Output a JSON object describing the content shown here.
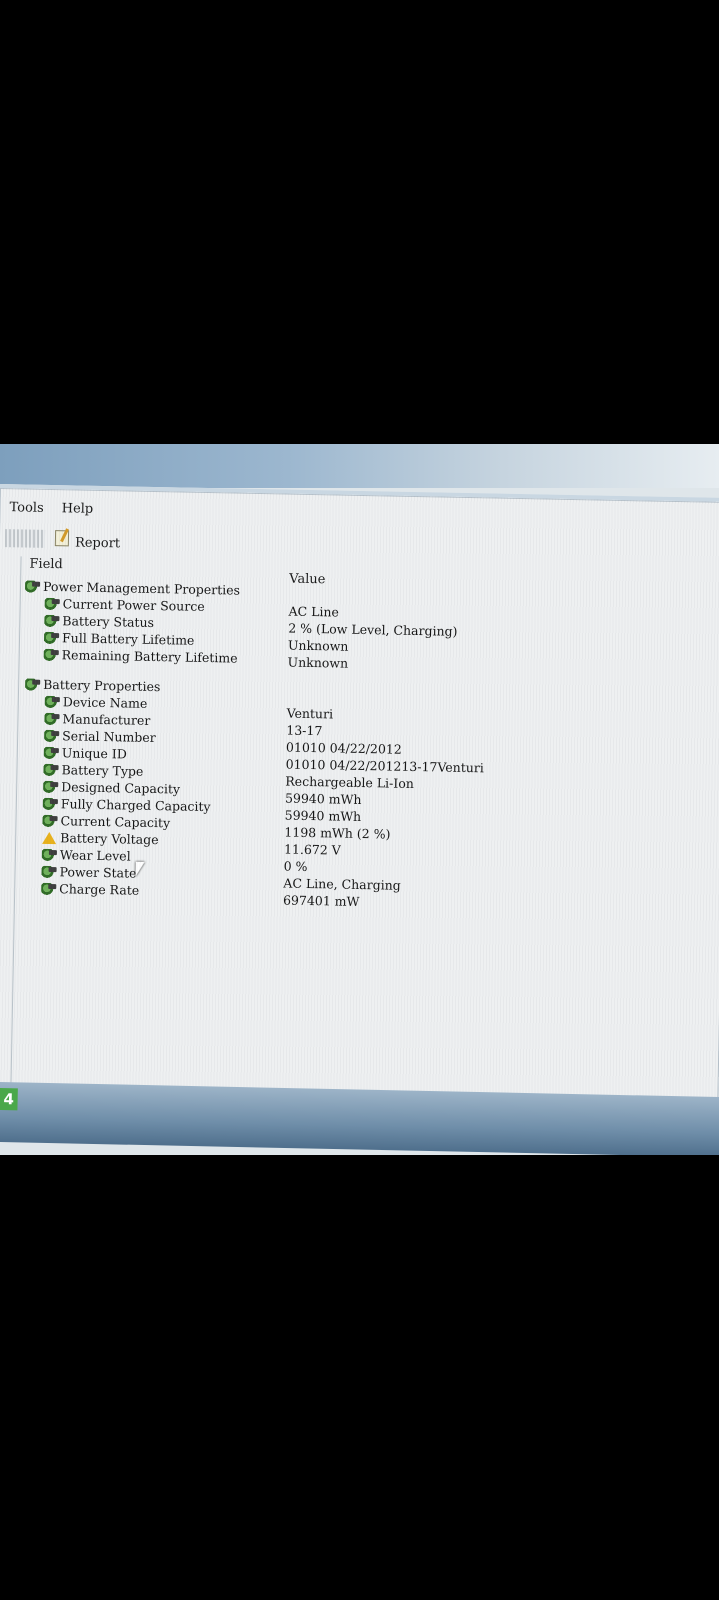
{
  "menubar": {
    "items": [
      "Tools",
      "Help"
    ]
  },
  "toolbar": {
    "report_label": "Report"
  },
  "columns": {
    "field": "Field",
    "value": "Value"
  },
  "groups": [
    {
      "title": "Power Management Properties",
      "rows": [
        {
          "field": "Current Power Source",
          "value": "AC Line"
        },
        {
          "field": "Battery Status",
          "value": "2 % (Low Level, Charging)"
        },
        {
          "field": "Full Battery Lifetime",
          "value": "Unknown"
        },
        {
          "field": "Remaining Battery Lifetime",
          "value": "Unknown"
        }
      ]
    },
    {
      "title": "Battery Properties",
      "rows": [
        {
          "field": "Device Name",
          "value": "Venturi"
        },
        {
          "field": "Manufacturer",
          "value": "13-17"
        },
        {
          "field": "Serial Number",
          "value": "01010 04/22/2012"
        },
        {
          "field": "Unique ID",
          "value": "01010 04/22/201213-17Venturi"
        },
        {
          "field": "Battery Type",
          "value": "Rechargeable Li-Ion"
        },
        {
          "field": "Designed Capacity",
          "value": "59940 mWh"
        },
        {
          "field": "Fully Charged Capacity",
          "value": "59940 mWh"
        },
        {
          "field": "Current Capacity",
          "value": "1198 mWh  (2 %)"
        },
        {
          "field": "Battery Voltage",
          "value": "11.672 V"
        },
        {
          "field": "Wear Level",
          "value": "0 %"
        },
        {
          "field": "Power State",
          "value": "AC Line, Charging"
        },
        {
          "field": "Charge Rate",
          "value": "697401 mW"
        }
      ]
    }
  ],
  "taskbar": {
    "badge": "4"
  }
}
